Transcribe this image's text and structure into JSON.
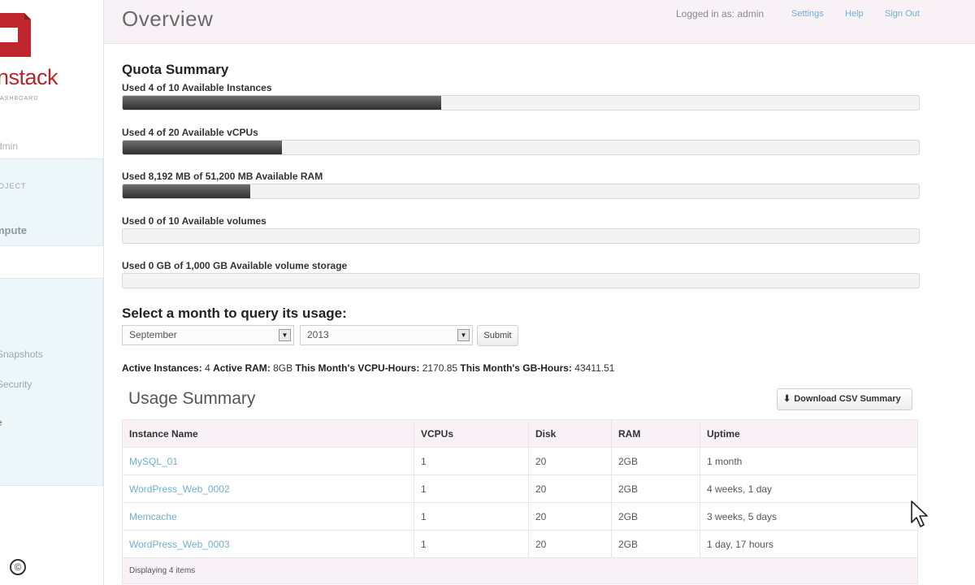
{
  "sidebar": {
    "logo_text": "nstack",
    "logo_sub": "ASHBOARD",
    "user_label": "dmin",
    "project_label": "OJECT",
    "project_name": "mpute",
    "nav_items": [
      "Snapshots",
      "Security",
      "e"
    ]
  },
  "header": {
    "title": "Overview",
    "logged_in": "Logged in as: admin",
    "settings": "Settings",
    "help": "Help",
    "sign_out": "Sign Out"
  },
  "quota": {
    "title": "Quota Summary",
    "items": [
      {
        "label": "Used 4 of 10 Available Instances",
        "fraction": 0.4
      },
      {
        "label": "Used 4 of 20 Available vCPUs",
        "fraction": 0.2
      },
      {
        "label": "Used 8,192 MB of 51,200 MB Available RAM",
        "fraction": 0.16
      },
      {
        "label": "Used 0 of 10 Available volumes",
        "fraction": 0
      },
      {
        "label": "Used 0 GB of 1,000 GB Available volume storage",
        "fraction": 0
      }
    ]
  },
  "usage_query": {
    "title": "Select a month to query its usage:",
    "month": "September",
    "year": "2013",
    "submit": "Submit"
  },
  "stats": {
    "active_instances_label": "Active Instances:",
    "active_instances": "4",
    "active_ram_label": "Active RAM:",
    "active_ram": "8GB",
    "vcpu_hours_label": "This Month's VCPU-Hours:",
    "vcpu_hours": "2170.85",
    "gb_hours_label": "This Month's GB-Hours:",
    "gb_hours": "43411.51"
  },
  "usage": {
    "title": "Usage Summary",
    "download": "Download CSV Summary",
    "columns": [
      "Instance Name",
      "VCPUs",
      "Disk",
      "RAM",
      "Uptime"
    ],
    "rows": [
      [
        "MySQL_01",
        "1",
        "20",
        "2GB",
        "1 month"
      ],
      [
        "WordPress_Web_0002",
        "1",
        "20",
        "2GB",
        "4 weeks, 1 day"
      ],
      [
        "Memcache",
        "1",
        "20",
        "2GB",
        "3 weeks, 5 days"
      ],
      [
        "WordPress_Web_0003",
        "1",
        "20",
        "2GB",
        "1 day, 17 hours"
      ]
    ],
    "footer": "Displaying 4 items"
  },
  "footer_mark": "©",
  "colors": {
    "accent_red": "#b8262c",
    "link": "#6fb0cf",
    "header_bg": "#f8f1f6"
  }
}
